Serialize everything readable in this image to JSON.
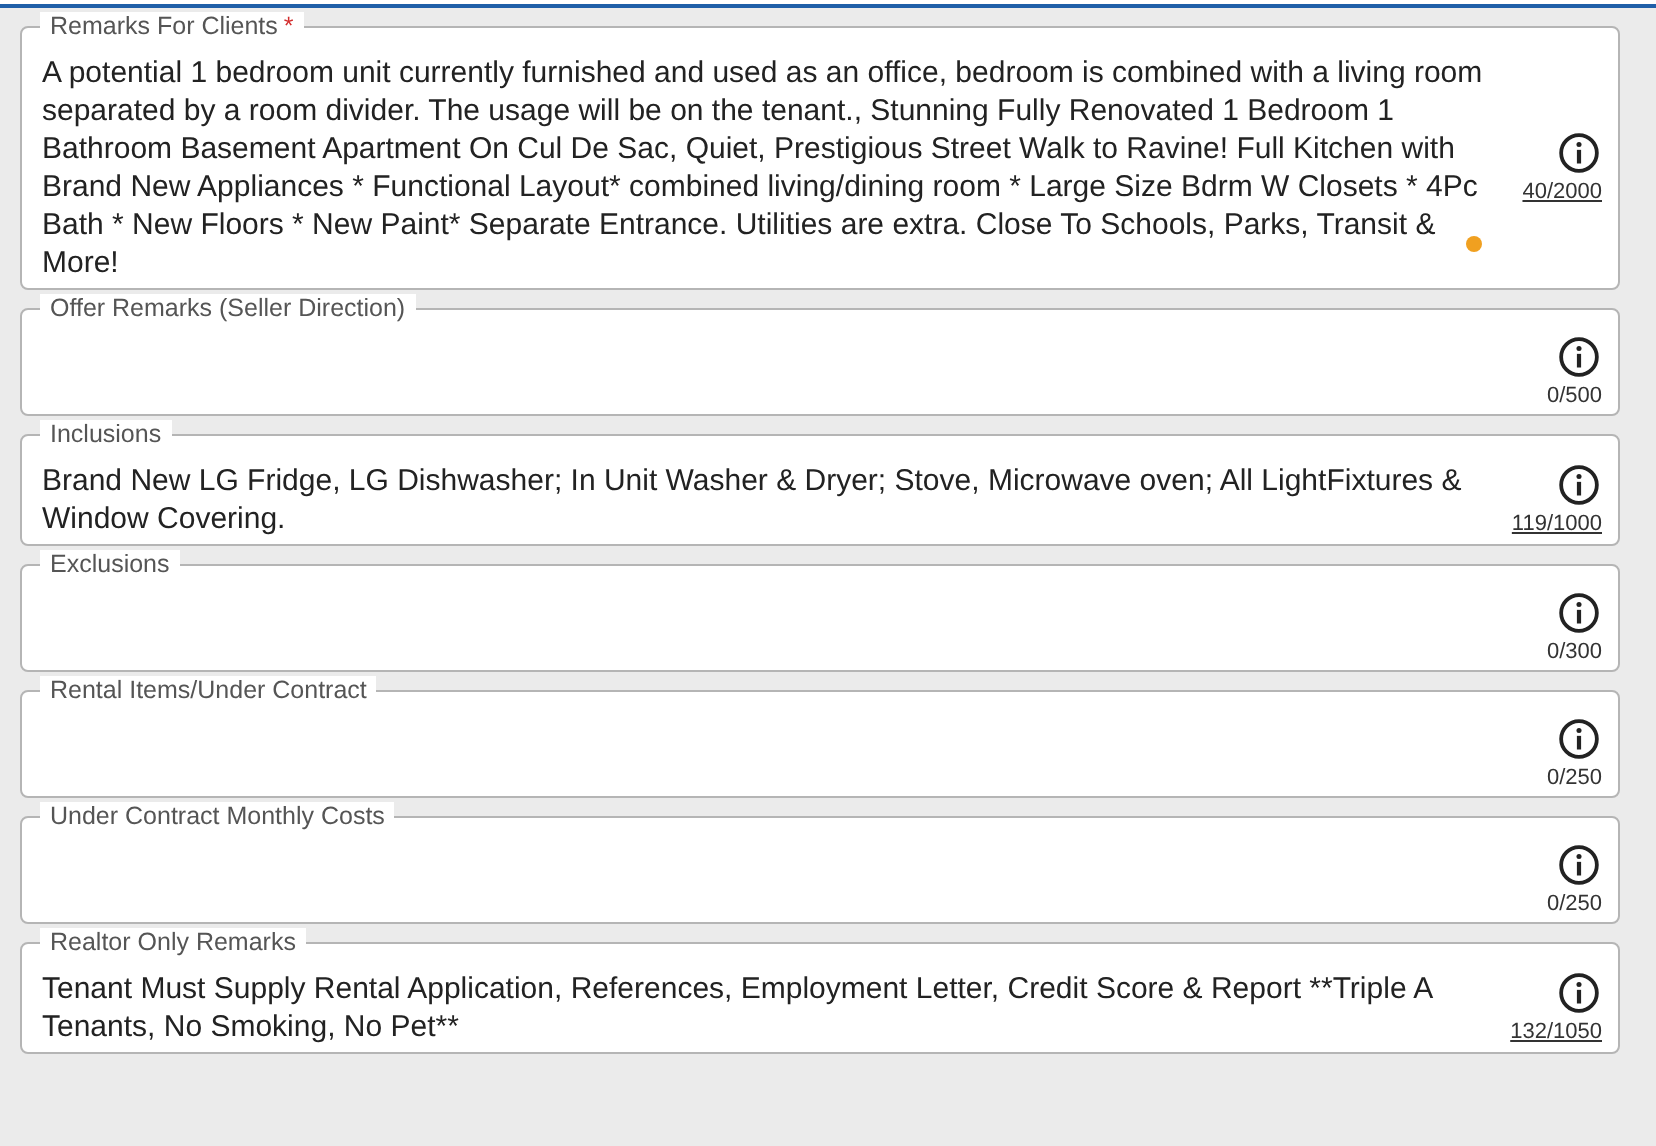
{
  "fields": [
    {
      "label": "Remarks For Clients",
      "required_mark": "*",
      "value": "A potential 1 bedroom unit currently furnished and used as an office, bedroom is combined with a living room separated by a room divider. The usage will be on the tenant., Stunning Fully Renovated 1 Bedroom 1 Bathroom Basement Apartment On Cul De Sac, Quiet, Prestigious Street Walk to Ravine! Full Kitchen with Brand New Appliances * Functional Layout* combined living/dining room * Large Size Bdrm W Closets * 4Pc Bath * New Floors * New Paint* Separate Entrance. Utilities are extra. Close To Schools, Parks, Transit & More!",
      "counter": "40/2000",
      "underlined": true,
      "status_dot": true
    },
    {
      "label": "Offer Remarks (Seller Direction)",
      "counter": "0/500",
      "underlined": false,
      "status_dot": false
    },
    {
      "label": "Inclusions",
      "value": "Brand New LG Fridge, LG Dishwasher; In Unit Washer & Dryer; Stove, Microwave oven; All LightFixtures & Window Covering.",
      "counter": "119/1000",
      "underlined": true,
      "status_dot": false
    },
    {
      "label": "Exclusions",
      "counter": "0/300",
      "underlined": false,
      "status_dot": false
    },
    {
      "label": "Rental Items/Under Contract",
      "counter": "0/250",
      "underlined": false,
      "status_dot": false
    },
    {
      "label": "Under Contract Monthly Costs",
      "counter": "0/250",
      "underlined": false,
      "status_dot": false
    },
    {
      "label": "Realtor Only Remarks",
      "value": "Tenant Must Supply Rental Application, References, Employment Letter, Credit Score & Report **Triple A Tenants, No Smoking, No Pet**",
      "counter": "132/1050",
      "underlined": true,
      "status_dot": false
    }
  ]
}
